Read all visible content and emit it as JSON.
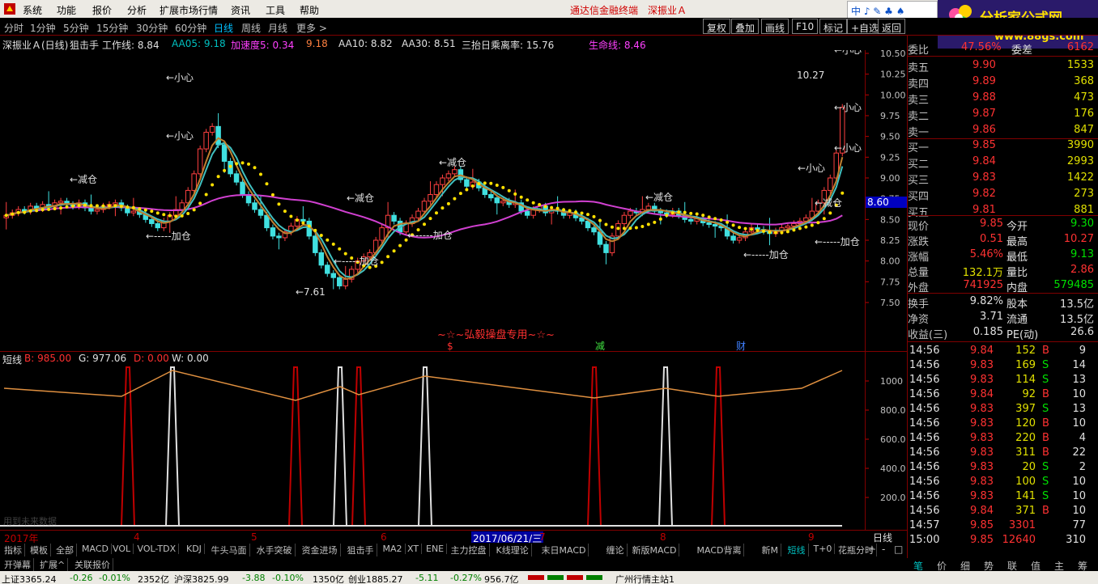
{
  "menubar": {
    "items": [
      "系统",
      "功能",
      "报价",
      "分析",
      "扩展市场行情",
      "资讯",
      "工具",
      "帮助"
    ],
    "brand_terminal": "通达信金融终端",
    "brand_stock": "深振业Ａ",
    "ime": "中 ♪ ✎ ♣ ♠",
    "logo_text": "分析家公式网",
    "logo_url": "www.88gs.com"
  },
  "toolbar": {
    "periods": [
      "分时",
      "1分钟",
      "5分钟",
      "15分钟",
      "30分钟",
      "60分钟",
      "日线",
      "周线",
      "月线",
      "更多 >"
    ],
    "active_period": "日线",
    "buttons": [
      "复权",
      "叠加",
      "画线",
      "F10",
      "标记",
      "+自选",
      "返回"
    ]
  },
  "info_line": {
    "stock": "深振业Ａ(日线)",
    "indicator": "狙击手",
    "work_line": "工作线: 8.84",
    "aa05": "AA05: 9.18",
    "accel": "加速度5: 0.34",
    "x918": "9.18",
    "aa10": "AA10: 8.82",
    "aa30": "AA30: 8.51",
    "santai": "三抬日乘离率: 15.76",
    "life": "生命线: 8.46"
  },
  "main_chart": {
    "y_ticks": [
      "10.50",
      "10.25",
      "10.00",
      "9.75",
      "9.50",
      "9.25",
      "9.00",
      "8.75",
      "8.50",
      "8.25",
      "8.00",
      "7.75",
      "7.50"
    ],
    "current_price_tag": "8.60",
    "annotations": {
      "xiaoxin": "←小心",
      "jiancang": "←减仓",
      "jiacang": "←-----加仓",
      "low": "←7.61",
      "high": "10.27",
      "watermark": "~☆~弘毅操盘专用~☆~",
      "sig_s": "$",
      "sig_jian": "减",
      "sig_cai": "财"
    }
  },
  "sub_chart": {
    "name": "短线",
    "b": "B: 985.00",
    "g": "G: 977.06",
    "d": "D: 0.00",
    "w": "W: 0.00",
    "y_ticks": [
      "1000",
      "800.0",
      "600.0",
      "400.0",
      "200.0"
    ],
    "future_note": "用到未来数据"
  },
  "date_axis": {
    "labels": [
      "2017年",
      "4",
      "5",
      "6",
      "7",
      "8",
      "9"
    ],
    "selected": "2017/06/21/三",
    "period": "日线"
  },
  "tabs_row1": [
    "指标",
    "模板",
    "全部",
    "MACD",
    "VOL",
    "VOL-TDX",
    "KDJ",
    "牛头马面",
    "水手突破",
    "资金进场",
    "狙击手",
    "MA2",
    "XT",
    "ENE",
    "主力控盘",
    "K线理论",
    "末日MACD",
    "缠论",
    "新版MACD",
    "MACD背离",
    "新M",
    "短线",
    "T+0",
    "花瓶分时"
  ],
  "tabs_row1_active": "短线",
  "tabs_row2": [
    "开弹幕",
    "扩展^",
    "关联报价"
  ],
  "tabs_row2_nav": [
    "+",
    "-",
    "□"
  ],
  "right_panel": {
    "weibi_label": "委比",
    "weibi": "47.56%",
    "weicha_label": "委差",
    "weicha": "6162",
    "sell": [
      {
        "label": "卖五",
        "price": "9.90",
        "vol": "1533"
      },
      {
        "label": "卖四",
        "price": "9.89",
        "vol": "368"
      },
      {
        "label": "卖三",
        "price": "9.88",
        "vol": "473"
      },
      {
        "label": "卖二",
        "price": "9.87",
        "vol": "176"
      },
      {
        "label": "卖一",
        "price": "9.86",
        "vol": "847"
      }
    ],
    "buy": [
      {
        "label": "买一",
        "price": "9.85",
        "vol": "3990"
      },
      {
        "label": "买二",
        "price": "9.84",
        "vol": "2993"
      },
      {
        "label": "买三",
        "price": "9.83",
        "vol": "1422"
      },
      {
        "label": "买四",
        "price": "9.82",
        "vol": "273"
      },
      {
        "label": "买五",
        "price": "9.81",
        "vol": "881"
      }
    ],
    "quote": [
      {
        "l1": "现价",
        "v1": "9.85",
        "l2": "今开",
        "v2": "9.30"
      },
      {
        "l1": "涨跌",
        "v1": "0.51",
        "l2": "最高",
        "v2": "10.27"
      },
      {
        "l1": "涨幅",
        "v1": "5.46%",
        "l2": "最低",
        "v2": "9.13"
      },
      {
        "l1": "总量",
        "v1": "132.1万",
        "l2": "量比",
        "v2": "2.86"
      },
      {
        "l1": "外盘",
        "v1": "741925",
        "l2": "内盘",
        "v2": "579485"
      }
    ],
    "fund": [
      {
        "l1": "换手",
        "v1": "9.82%",
        "l2": "股本",
        "v2": "13.5亿"
      },
      {
        "l1": "净资",
        "v1": "3.71",
        "l2": "流通",
        "v2": "13.5亿"
      },
      {
        "l1": "收益(三)",
        "v1": "0.185",
        "l2": "PE(动)",
        "v2": "26.6"
      }
    ],
    "ticks": [
      {
        "t": "14:56",
        "p": "9.84",
        "v": "152",
        "d": "B",
        "n": "9"
      },
      {
        "t": "14:56",
        "p": "9.83",
        "v": "169",
        "d": "S",
        "n": "14"
      },
      {
        "t": "14:56",
        "p": "9.83",
        "v": "114",
        "d": "S",
        "n": "13"
      },
      {
        "t": "14:56",
        "p": "9.84",
        "v": "92",
        "d": "B",
        "n": "10"
      },
      {
        "t": "14:56",
        "p": "9.83",
        "v": "397",
        "d": "S",
        "n": "13"
      },
      {
        "t": "14:56",
        "p": "9.83",
        "v": "120",
        "d": "B",
        "n": "10"
      },
      {
        "t": "14:56",
        "p": "9.83",
        "v": "220",
        "d": "B",
        "n": "4"
      },
      {
        "t": "14:56",
        "p": "9.83",
        "v": "311",
        "d": "B",
        "n": "22"
      },
      {
        "t": "14:56",
        "p": "9.83",
        "v": "20",
        "d": "S",
        "n": "2"
      },
      {
        "t": "14:56",
        "p": "9.83",
        "v": "100",
        "d": "S",
        "n": "10"
      },
      {
        "t": "14:56",
        "p": "9.83",
        "v": "141",
        "d": "S",
        "n": "10"
      },
      {
        "t": "14:56",
        "p": "9.84",
        "v": "371",
        "d": "B",
        "n": "10"
      },
      {
        "t": "14:57",
        "p": "9.85",
        "v": "3301",
        "d": "",
        "n": "77"
      },
      {
        "t": "15:00",
        "p": "9.85",
        "v": "12640",
        "d": "",
        "n": "310"
      }
    ],
    "bottom_tabs": [
      "笔",
      "价",
      "细",
      "势",
      "联",
      "值",
      "主",
      "筹"
    ]
  },
  "statusbar": {
    "sh": "上证3365.24",
    "sh_chg": "-0.26",
    "sh_pct": "-0.01%",
    "sh_amt": "2352亿",
    "sz": "沪深3825.99",
    "sz_chg": "-3.88",
    "sz_pct": "-0.10%",
    "sz_amt": "1350亿",
    "cy": "创业1885.27",
    "cy_chg": "-5.11",
    "cy_pct": "-0.27%",
    "cy_amt": "956.7亿",
    "server": "广州行情主站1"
  }
}
